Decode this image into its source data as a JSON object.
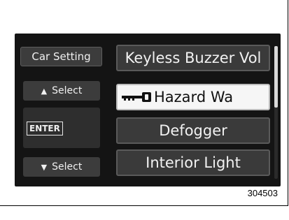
{
  "left_buttons": {
    "car_setting": "Car Setting",
    "up_select": "Select",
    "enter": "ENTER",
    "down_select": "Select"
  },
  "icons": {
    "up": "up-triangle-icon",
    "down": "down-triangle-icon",
    "selected_item": "key-icon"
  },
  "menu": {
    "items": [
      {
        "label": "Keyless Buzzer Vol"
      },
      {
        "label": "Hazard Wa",
        "selected": true
      },
      {
        "label": "Defogger"
      },
      {
        "label": "Interior Light"
      }
    ]
  },
  "scrollbar": {
    "position": 0
  },
  "figure_code": "304503",
  "colors": {
    "screen_bg": "#141414",
    "button_bg": "#3a3a3a",
    "selected_bg": "#f6f6f6",
    "text": "#f2f2f2"
  }
}
